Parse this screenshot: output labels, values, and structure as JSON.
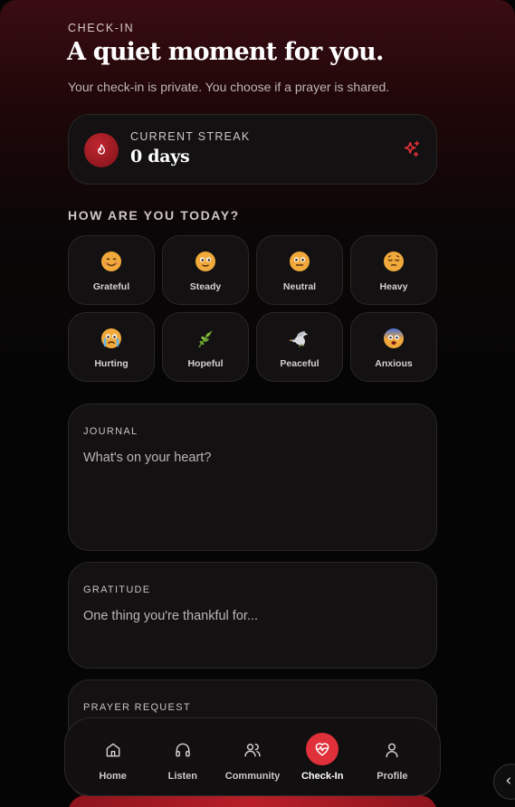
{
  "header": {
    "eyebrow": "CHECK-IN",
    "title": "A quiet moment for you.",
    "subtitle": "Your check-in is private. You choose if a prayer is shared."
  },
  "streak": {
    "label": "CURRENT STREAK",
    "value": "0 days",
    "icon": "flame-icon",
    "action_icon": "sparkles-icon"
  },
  "moods": {
    "heading": "HOW ARE YOU TODAY?",
    "items": [
      {
        "label": "Grateful",
        "icon": "smiling-face-icon"
      },
      {
        "label": "Steady",
        "icon": "calm-face-icon"
      },
      {
        "label": "Neutral",
        "icon": "neutral-face-icon"
      },
      {
        "label": "Heavy",
        "icon": "pensive-face-icon"
      },
      {
        "label": "Hurting",
        "icon": "crying-face-icon"
      },
      {
        "label": "Hopeful",
        "icon": "herb-icon"
      },
      {
        "label": "Peaceful",
        "icon": "dove-icon"
      },
      {
        "label": "Anxious",
        "icon": "anxious-face-icon"
      }
    ]
  },
  "journal": {
    "label": "JOURNAL",
    "placeholder": "What's on your heart?"
  },
  "gratitude": {
    "label": "GRATITUDE",
    "placeholder": "One thing you're thankful for..."
  },
  "prayer": {
    "label": "PRAYER REQUEST"
  },
  "tabs": [
    {
      "label": "Home",
      "icon": "home-icon"
    },
    {
      "label": "Listen",
      "icon": "headphones-icon"
    },
    {
      "label": "Community",
      "icon": "users-icon"
    },
    {
      "label": "Check-In",
      "icon": "heart-pulse-icon",
      "active": true
    },
    {
      "label": "Profile",
      "icon": "user-icon"
    }
  ],
  "colors": {
    "accent": "#e0303a",
    "background": "#050505",
    "card": "#131112"
  }
}
